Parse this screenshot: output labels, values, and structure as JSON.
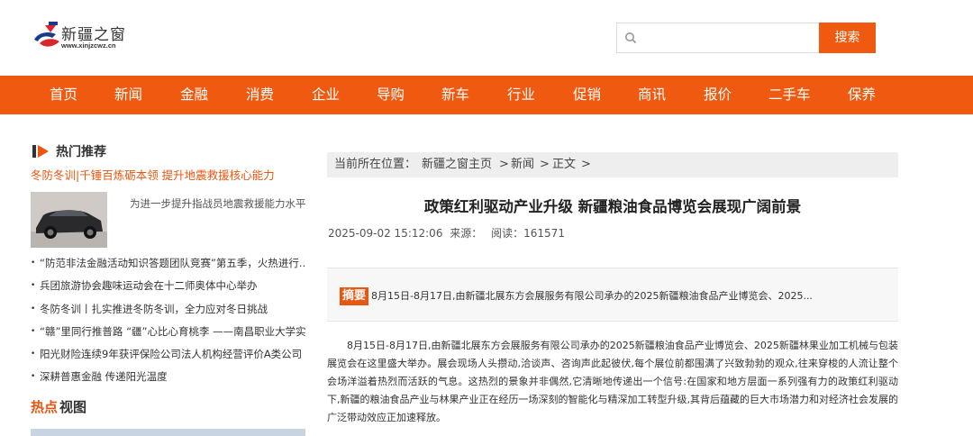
{
  "header": {
    "logo_name": "新疆之窗",
    "logo_url": "www.xinjzcwz.cn",
    "search_placeholder": "",
    "search_button": "搜索"
  },
  "nav": {
    "items": [
      "首页",
      "新闻",
      "金融",
      "消费",
      "企业",
      "导购",
      "新车",
      "行业",
      "促销",
      "商讯",
      "报价",
      "二手车",
      "保养"
    ]
  },
  "sidebar": {
    "title": "热门推荐",
    "headline": "冬防冬训|千锤百炼砺本领 提升地震救援核心能力",
    "thumb_text": "为进一步提升指战员地震救援能力水平,",
    "list": [
      "“防范非法金融活动知识答题团队竞赛”第五季，火热进行...",
      "兵团旅游协会趣味运动会在十二师奥体中心举办",
      "冬防冬训丨扎实推进冬防冬训，全力应对冬日挑战",
      "“赣”里同行推普路 “疆”心比心育桃李 ——南昌职业大学实...",
      "阳光财险连续9年获评保险公司法人机构经营评价A类公司",
      "深耕普惠金融 传递阳光温度"
    ],
    "hot_a": "热点",
    "hot_b": "视图"
  },
  "breadcrumb": {
    "label": "当前所在位置：",
    "home": "新疆之窗主页",
    "sep": ">",
    "section": "新闻",
    "current": "正文"
  },
  "article": {
    "title": "政策红利驱动产业升级 新疆粮油食品博览会展现广阔前景",
    "datetime": "2025-09-02 15:12:06",
    "source_label": "来源：",
    "source": "",
    "reads_label": "阅读：",
    "reads": "161571",
    "summary_tag": "摘要",
    "summary": "8月15日-8月17日,由新疆北展东方会展服务有限公司承办的2025新疆粮油食品产业博览会、2025...",
    "body": "8月15日-8月17日,由新疆北展东方会展服务有限公司承办的2025新疆粮油食品产业博览会、2025新疆林果业加工机械与包装展览会在这里盛大举办。展会现场人头攒动,洽谈声、咨询声此起彼伏,每个展位前都围满了兴致勃勃的观众,往来穿梭的人流让整个会场洋溢着热烈而活跃的气息。这热烈的景象并非偶然,它清晰地传递出一个信号:在国家和地方层面一系列强有力的政策红利驱动下,新疆的粮油食品产业与林果产业正在经历一场深刻的智能化与精深加工转型升级,其背后蕴藏的巨大市场潜力和对经济社会发展的广泛带动效应正加速释放。"
  },
  "colors": {
    "accent": "#f05a10",
    "breadcrumb_bg": "#eeeeee",
    "summary_bg": "#f7f7f7"
  }
}
